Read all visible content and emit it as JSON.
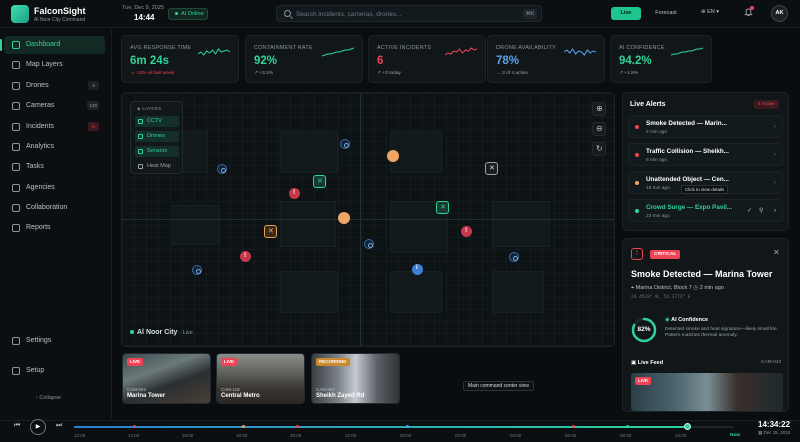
{
  "app": {
    "name": "FalconSight",
    "subtitle": "Al Noor City Command",
    "date": "Tue, Dec 9, 2025",
    "time": "14:44",
    "status": "AI Online"
  },
  "search": {
    "placeholder": "Search incidents, cameras, drones...",
    "shortcut": "⌘K"
  },
  "header": {
    "live_label": "Live",
    "forecast_label": "Forecast",
    "language": "EN",
    "avatar_initials": "AK"
  },
  "sidebar": {
    "items": [
      {
        "label": "Dashboard",
        "count": ""
      },
      {
        "label": "Map Layers",
        "count": ""
      },
      {
        "label": "Drones",
        "count": "4"
      },
      {
        "label": "Cameras",
        "count": "120"
      },
      {
        "label": "Incidents",
        "count": "6"
      },
      {
        "label": "Analytics",
        "count": ""
      },
      {
        "label": "Tasks",
        "count": ""
      },
      {
        "label": "Agencies",
        "count": ""
      },
      {
        "label": "Collaboration",
        "count": ""
      },
      {
        "label": "Reports",
        "count": ""
      },
      {
        "label": "Settings",
        "count": ""
      },
      {
        "label": "Setup",
        "count": ""
      }
    ],
    "collapse_label": "Collapse"
  },
  "kpis": [
    {
      "title": "Avg Response Time",
      "value": "6m 24s",
      "delta": "↘ -12% vs last week",
      "color": "#2fd39a",
      "delta_color": "#ef4455"
    },
    {
      "title": "Containment Rate",
      "value": "92%",
      "delta": "↗ +3.2%",
      "color": "#2fd39a",
      "delta_color": "#9aa4aa"
    },
    {
      "title": "Active Incidents",
      "value": "6",
      "delta": "↗ +3 today",
      "color": "#ef4455",
      "delta_color": "#9aa4aa"
    },
    {
      "title": "Drone Availability",
      "value": "78%",
      "delta": "→ 3 of 4 active",
      "color": "#5aa2f0",
      "delta_color": "#9aa4aa"
    },
    {
      "title": "AI Confidence",
      "value": "94.2%",
      "delta": "↗ +1.8%",
      "color": "#2fd39a",
      "delta_color": "#9aa4aa"
    }
  ],
  "map": {
    "layers_title": "LAYERS",
    "layers": [
      {
        "label": "CCTV",
        "on": true
      },
      {
        "label": "Drones",
        "on": true
      },
      {
        "label": "Sensors",
        "on": true
      },
      {
        "label": "Heat Map",
        "on": false
      }
    ],
    "area_name": "Al Noor City",
    "area_status": "Live"
  },
  "cameras": [
    {
      "badge": "LIVE",
      "code": "CAM-042",
      "name": "Marina Tower"
    },
    {
      "badge": "LIVE",
      "code": "CAM-118",
      "name": "Central Metro"
    },
    {
      "badge": "RECORDING",
      "code": "CAM-067",
      "name": "Sheikh Zayed Rd"
    }
  ],
  "map_tooltip": "Main command center view",
  "alerts": {
    "title": "Live Alerts",
    "badge": "4 Active",
    "hint": "Click to view details",
    "items": [
      {
        "title": "Smoke Detected — Marin...",
        "time": "2 min ago",
        "color": "#ef4455"
      },
      {
        "title": "Traffic Collision — Sheikh...",
        "time": "8 min ago",
        "color": "#ef4455"
      },
      {
        "title": "Unattended Object — Cen...",
        "time": "15 min ago",
        "color": "#f0a562"
      },
      {
        "title": "Crowd Surge — Expo Pavil...",
        "time": "23 min ago",
        "color": "#2fd39a"
      }
    ]
  },
  "incident": {
    "severity": "CRITICAL",
    "title": "Smoke Detected — Marina Tower",
    "location": "Marina District, Block 7",
    "time": "2 min ago",
    "coords": "24.4539° N, 54.3773° E",
    "ai_title": "AI Confidence",
    "ai_value": "82%",
    "ai_percent": 82,
    "ai_desc": "Detected smoke and heat signature—likely small fire. Pattern matches thermal anomaly.",
    "feed_title": "Live Feed",
    "feed_code": "CAM-042",
    "feed_badge": "LIVE"
  },
  "timeline": {
    "ticks": [
      "12:00",
      "14:00",
      "16:00",
      "18:00",
      "20:00",
      "22:00",
      "00:00",
      "02:00",
      "04:00",
      "06:00",
      "08:00",
      "10:00"
    ],
    "now_label": "Now",
    "time": "14:34:22",
    "date": "Dec 15, 2024"
  }
}
